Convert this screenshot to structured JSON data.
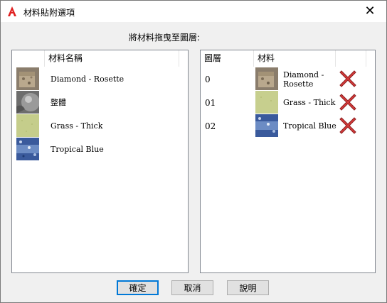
{
  "window": {
    "title": "材料貼附選項",
    "close_glyph": "✕"
  },
  "instruction": "將材料拖曳至圖層:",
  "left_panel": {
    "header": "材料名稱",
    "items": [
      {
        "name": "Diamond - Rosette",
        "thumb": "stone-thumbnail"
      },
      {
        "name": "整體",
        "thumb": "sphere-thumbnail"
      },
      {
        "name": "Grass - Thick",
        "thumb": "grass-thumbnail"
      },
      {
        "name": "Tropical Blue",
        "thumb": "blue-granite-thumbnail"
      }
    ]
  },
  "right_panel": {
    "header_layer": "圖層",
    "header_material": "材料",
    "rows": [
      {
        "layer": "0",
        "material_line1": "Diamond -",
        "material_line2": "Rosette",
        "thumb": "stone-thumbnail"
      },
      {
        "layer": "01",
        "material_line1": "Grass - Thick",
        "material_line2": "",
        "thumb": "grass-thumbnail"
      },
      {
        "layer": "02",
        "material_line1": "Tropical Blue",
        "material_line2": "",
        "thumb": "blue-granite-thumbnail"
      }
    ]
  },
  "buttons": {
    "ok": "確定",
    "cancel": "取消",
    "help": "說明"
  },
  "colors": {
    "accent": "#0078d7",
    "delete_red": "#d83b3b",
    "app_icon_red": "#e02020"
  }
}
